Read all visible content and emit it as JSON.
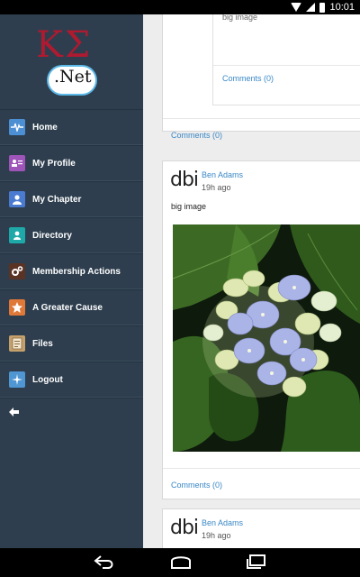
{
  "status": {
    "time": "10:01"
  },
  "logo": {
    "letters": "ΚΣ",
    "subtitle": ".Net"
  },
  "menu": [
    {
      "label": "Home",
      "icon": "pulse-icon",
      "color": "#4d8fd3"
    },
    {
      "label": "My Profile",
      "icon": "profile-card-icon",
      "color": "#9e54b8"
    },
    {
      "label": "My Chapter",
      "icon": "person-icon",
      "color": "#4a7bd1"
    },
    {
      "label": "Directory",
      "icon": "directory-icon",
      "color": "#1ea8a8"
    },
    {
      "label": "Membership Actions",
      "icon": "gears-icon",
      "color": "#5a3325"
    },
    {
      "label": "A Greater Cause",
      "icon": "star-person-icon",
      "color": "#e07838"
    },
    {
      "label": "Files",
      "icon": "document-icon",
      "color": "#c4a06c"
    },
    {
      "label": "Logout",
      "icon": "compass-icon",
      "color": "#4f96d3"
    }
  ],
  "feed": {
    "top_nested_text": "big image",
    "nested_comments": "Comments (0)",
    "top_card_comments": "Comments (0)",
    "post1": {
      "avatar": "dbi",
      "author": "Ben Adams",
      "time": "19h ago",
      "text": "big image",
      "comments": "Comments (0)"
    },
    "post2": {
      "avatar": "dbi",
      "author": "Ben Adams",
      "time": "19h ago"
    }
  }
}
